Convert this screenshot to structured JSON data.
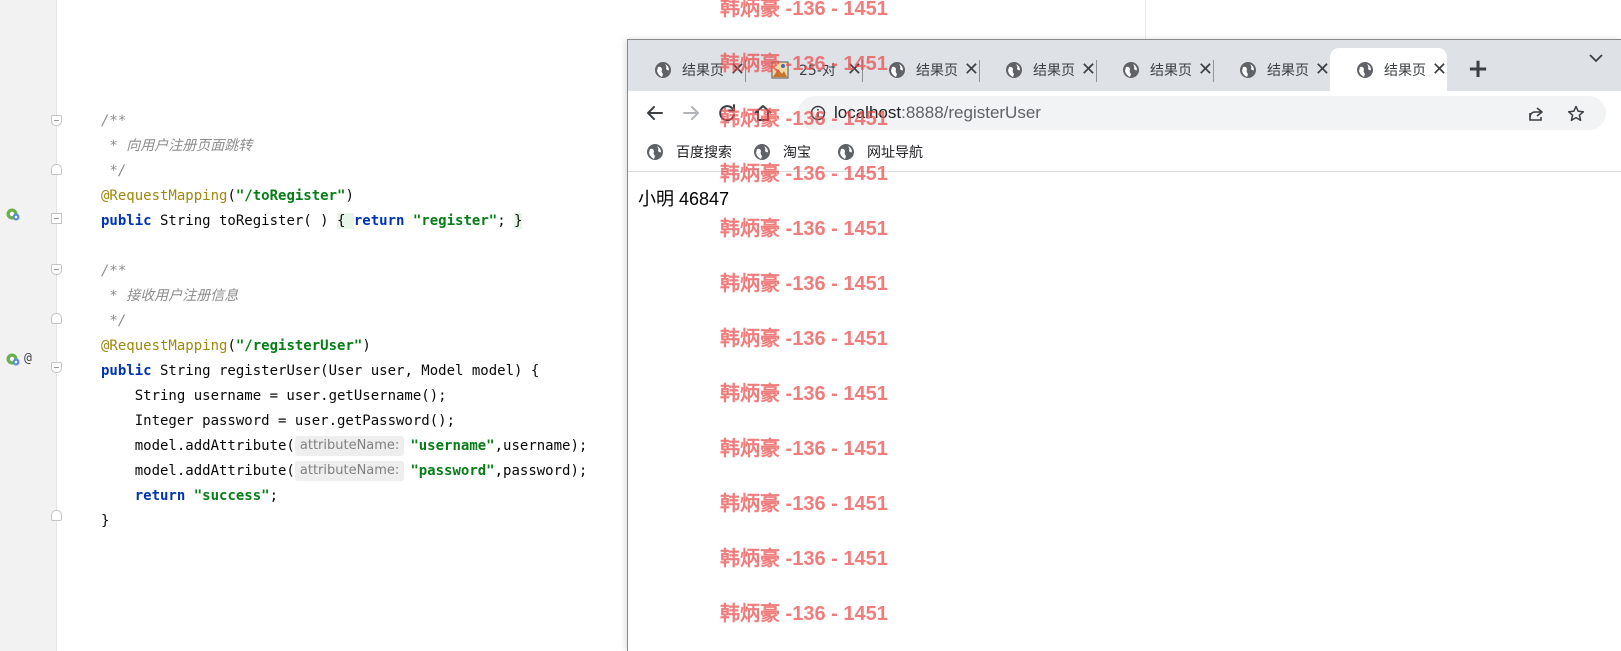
{
  "editor": {
    "lines": [
      {
        "tokens": [
          {
            "t": "/**",
            "c": "comment"
          }
        ]
      },
      {
        "tokens": [
          {
            "t": " * 向用户注册页面跳转",
            "c": "comment"
          }
        ]
      },
      {
        "tokens": [
          {
            "t": " */",
            "c": "comment"
          }
        ]
      },
      {
        "tokens": [
          {
            "t": "@RequestMapping",
            "c": "annot"
          },
          {
            "t": "(",
            "c": ""
          },
          {
            "t": "\"/toRegister\"",
            "c": "str"
          },
          {
            "t": ")",
            "c": ""
          }
        ]
      },
      {
        "tokens": [
          {
            "t": "public",
            "c": "kw"
          },
          {
            "t": " String toRegister( ) ",
            "c": ""
          },
          {
            "t": "{ ",
            "c": "hl"
          },
          {
            "t": "return",
            "c": "kw"
          },
          {
            "t": " ",
            "c": ""
          },
          {
            "t": "\"register\"",
            "c": "str"
          },
          {
            "t": "; ",
            "c": ""
          },
          {
            "t": "}",
            "c": "hl"
          }
        ]
      },
      {
        "tokens": [
          {
            "t": "",
            "c": ""
          }
        ]
      },
      {
        "tokens": [
          {
            "t": "/**",
            "c": "comment"
          }
        ]
      },
      {
        "tokens": [
          {
            "t": " * 接收用户注册信息",
            "c": "comment"
          }
        ]
      },
      {
        "tokens": [
          {
            "t": " */",
            "c": "comment"
          }
        ]
      },
      {
        "tokens": [
          {
            "t": "@RequestMapping",
            "c": "annot"
          },
          {
            "t": "(",
            "c": ""
          },
          {
            "t": "\"/registerUser\"",
            "c": "str"
          },
          {
            "t": ")",
            "c": ""
          }
        ]
      },
      {
        "tokens": [
          {
            "t": "public",
            "c": "kw"
          },
          {
            "t": " String registerUser(User user, Model model) {",
            "c": ""
          }
        ]
      },
      {
        "tokens": [
          {
            "t": "    String username = user.getUsername();",
            "c": ""
          }
        ]
      },
      {
        "tokens": [
          {
            "t": "    Integer password = user.getPassword();",
            "c": ""
          }
        ]
      },
      {
        "tokens": [
          {
            "t": "    model.addAttribute(",
            "c": ""
          },
          {
            "t": "attributeName:",
            "c": "hint"
          },
          {
            "t": "\"username\"",
            "c": "str"
          },
          {
            "t": ",username);",
            "c": ""
          }
        ]
      },
      {
        "tokens": [
          {
            "t": "    model.addAttribute(",
            "c": ""
          },
          {
            "t": "attributeName:",
            "c": "hint"
          },
          {
            "t": "\"password\"",
            "c": "str"
          },
          {
            "t": ",password);",
            "c": ""
          }
        ]
      },
      {
        "tokens": [
          {
            "t": "    ",
            "c": ""
          },
          {
            "t": "return",
            "c": "kw"
          },
          {
            "t": " ",
            "c": ""
          },
          {
            "t": "\"success\"",
            "c": "str"
          },
          {
            "t": ";",
            "c": ""
          }
        ]
      },
      {
        "tokens": [
          {
            "t": "}",
            "c": ""
          }
        ]
      }
    ],
    "gutter_at_symbol": "@"
  },
  "browser": {
    "tabs": [
      {
        "title": "结果页",
        "close": "✕",
        "active": false,
        "icon": "globe-icon"
      },
      {
        "title": "25-对",
        "close": "✕",
        "active": false,
        "icon": "image-favicon"
      },
      {
        "title": "结果页",
        "close": "✕",
        "active": false,
        "icon": "globe-icon"
      },
      {
        "title": "结果页",
        "close": "✕",
        "active": false,
        "icon": "globe-icon"
      },
      {
        "title": "结果页",
        "close": "✕",
        "active": false,
        "icon": "globe-icon"
      },
      {
        "title": "结果页",
        "close": "✕",
        "active": false,
        "icon": "globe-icon"
      },
      {
        "title": "结果页",
        "close": "✕",
        "active": true,
        "icon": "globe-icon"
      }
    ],
    "new_tab_label": "+",
    "tab_menu_label": "⌄",
    "url_host": "localhost",
    "url_path": ":8888/registerUser",
    "bookmarks": [
      {
        "label": "百度搜索",
        "icon": "globe-icon"
      },
      {
        "label": "淘宝",
        "icon": "globe-icon"
      },
      {
        "label": "网址导航",
        "icon": "globe-icon"
      }
    ],
    "page_text": "小明 46847"
  },
  "watermark": {
    "text": "韩炳豪 -136 - 1451",
    "color": "#ec4a4a",
    "rows": 12
  }
}
